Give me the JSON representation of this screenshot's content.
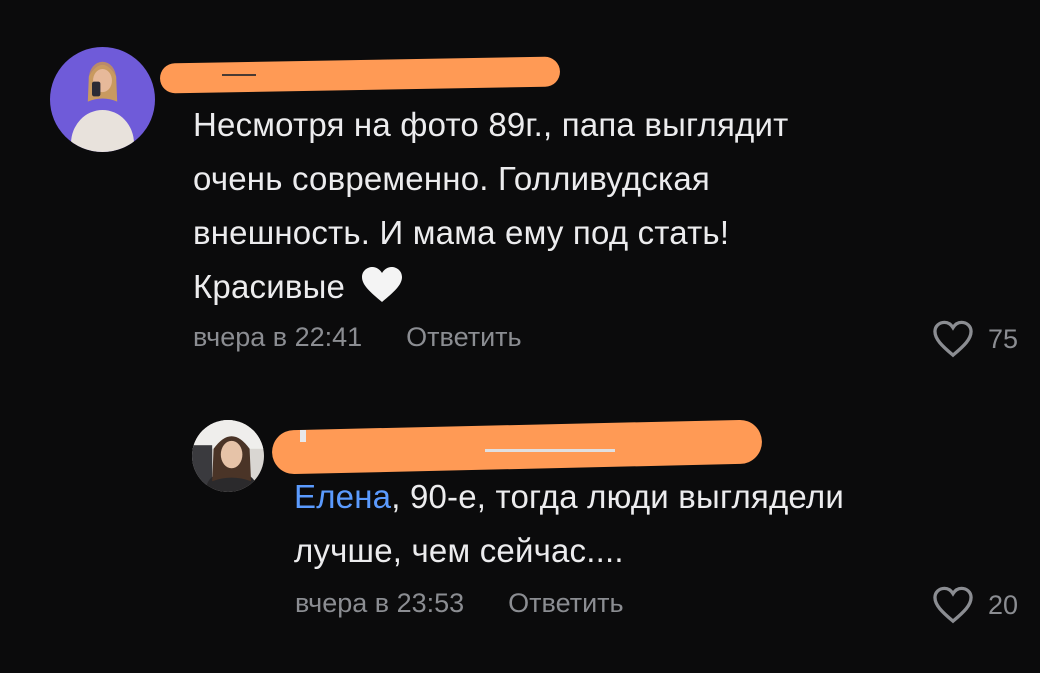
{
  "comments": [
    {
      "avatar": "user-avatar-woman-lavender",
      "author_name": "",
      "text_lines": [
        "Несмотря на фото 89г., папа выглядит",
        "очень современно. Голливудская",
        "внешность. И мама ему под стать!"
      ],
      "text_last": "Красивые",
      "emoji": "white-heart-icon",
      "timestamp": "вчера в 22:41",
      "reply_label": "Ответить",
      "likes": "75"
    },
    {
      "avatar": "user-avatar-woman-car",
      "author_name": "",
      "mention": "Елена",
      "text_after_mention": ", 90-е, тогда люди выглядели",
      "text_line2": "лучше, чем сейчас....",
      "timestamp": "вчера в 23:53",
      "reply_label": "Ответить",
      "likes": "20"
    }
  ],
  "colors": {
    "background": "#0b0b0c",
    "text": "#ececee",
    "muted": "#8b8d92",
    "mention": "#5b9bff",
    "redaction": "#ff9a55"
  }
}
